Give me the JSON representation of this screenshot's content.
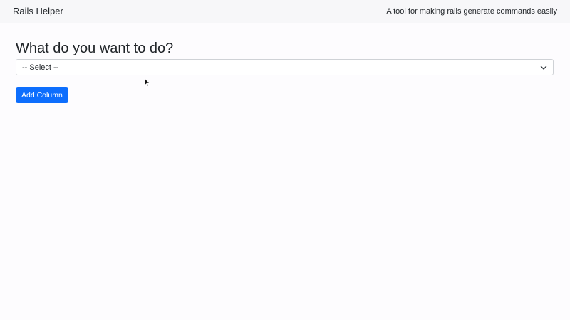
{
  "navbar": {
    "brand": "Rails Helper",
    "tagline": "A tool for making rails generate commands easily"
  },
  "main": {
    "heading": "What do you want to do?",
    "select": {
      "selected": "-- Select --",
      "icon": "chevron-down-icon"
    },
    "add_button_label": "Add Column"
  },
  "colors": {
    "navbar_bg": "#f7f7f9",
    "page_bg": "#fdfcfe",
    "primary": "#0d6efd"
  }
}
